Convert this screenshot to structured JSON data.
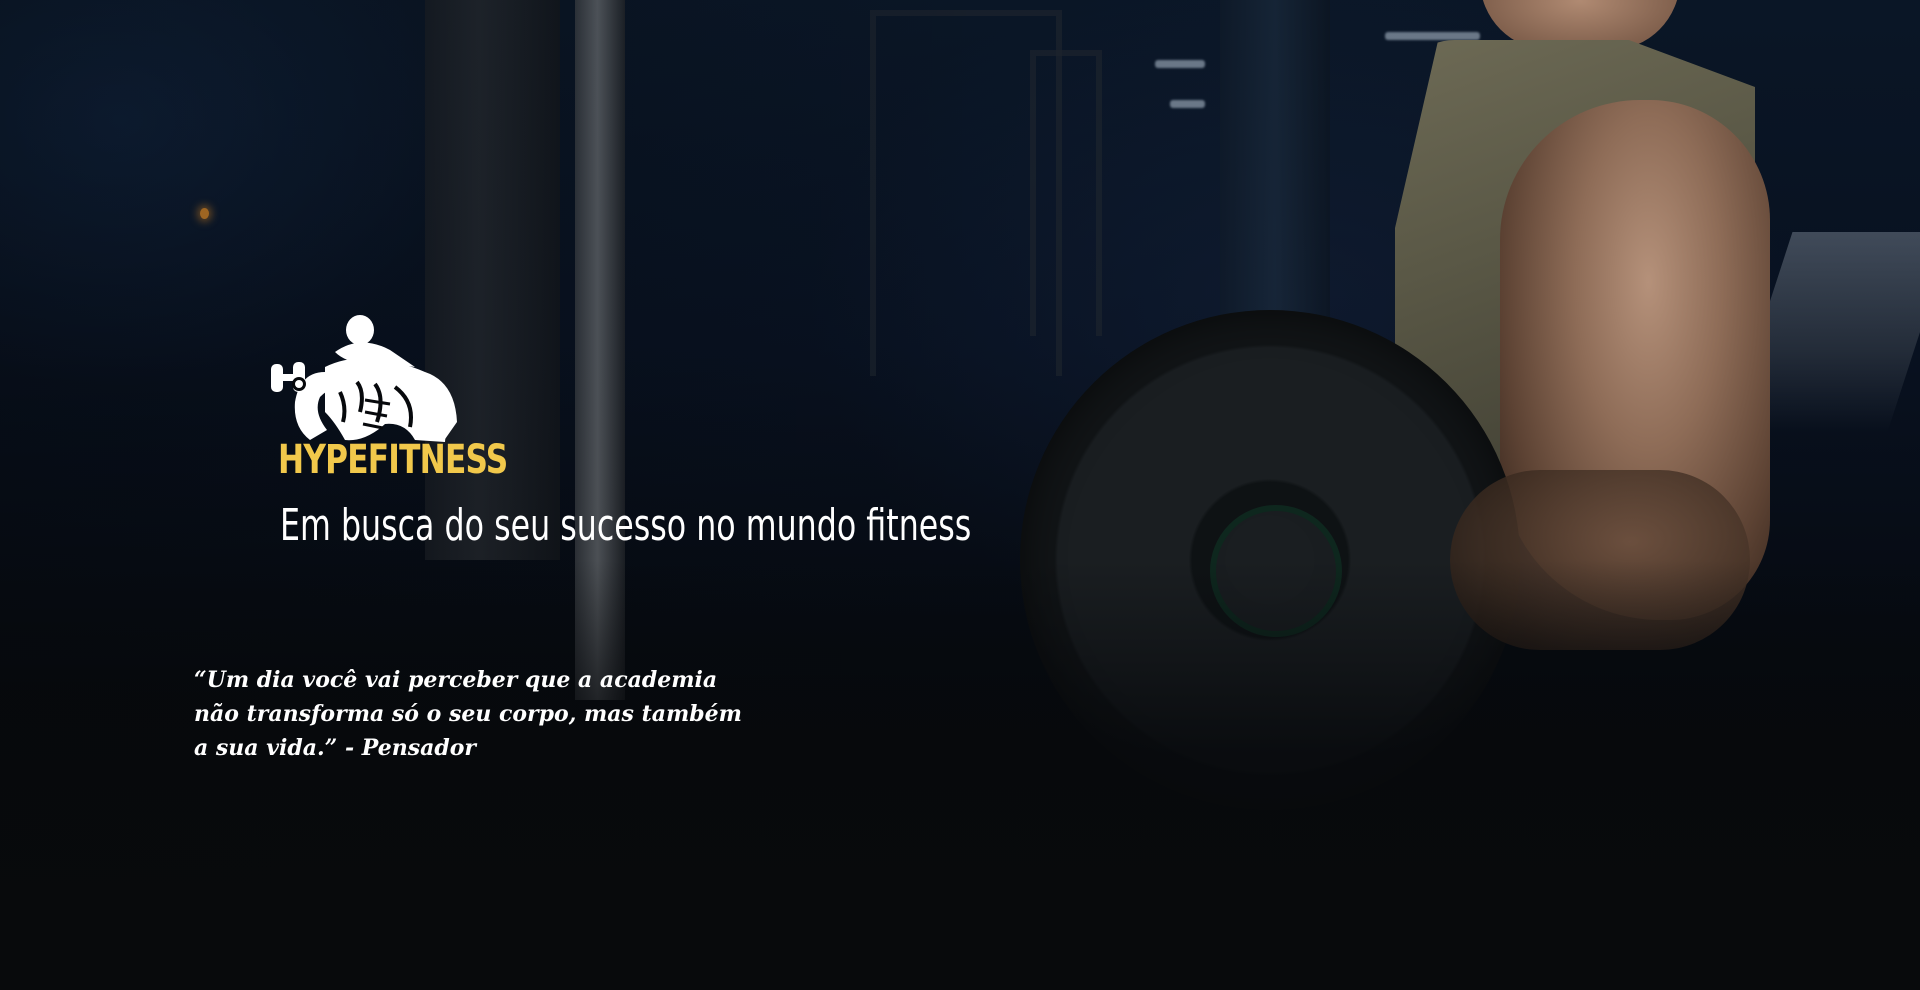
{
  "brand": {
    "name": "HYPEFITNESS",
    "logo_icon": "bodybuilder-dumbbell-curl-icon",
    "accent_color": "#f1c84b"
  },
  "hero": {
    "tagline": "Em busca do seu sucesso no mundo fitness",
    "quote": "“Um dia você vai perceber que a academia não transforma só o seu corpo, mas também a sua vida.” - Pensador"
  }
}
